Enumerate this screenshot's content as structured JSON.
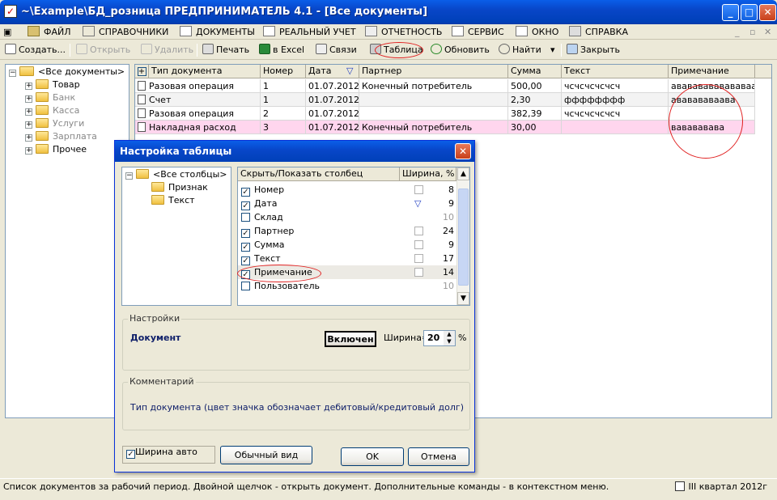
{
  "window": {
    "title": "~\\Example\\БД_розница  ПРЕДПРИНИМАТЕЛЬ 4.1 - [Все документы]"
  },
  "menu": [
    {
      "label": "ФАЙЛ",
      "icon": "folder-open-icon"
    },
    {
      "label": "СПРАВОЧНИКИ",
      "icon": "home-icon"
    },
    {
      "label": "ДОКУМЕНТЫ",
      "icon": "document-icon"
    },
    {
      "label": "РЕАЛЬНЫЙ УЧЕТ",
      "icon": "list-icon"
    },
    {
      "label": "ОТЧЕТНОСТЬ",
      "icon": "report-icon"
    },
    {
      "label": "СЕРВИС",
      "icon": "service-icon"
    },
    {
      "label": "ОКНО",
      "icon": "window-icon"
    },
    {
      "label": "СПРАВКА",
      "icon": "help-book-icon"
    }
  ],
  "toolbar": {
    "create": "Создать...",
    "open": "Открыть",
    "delete": "Удалить",
    "print": "Печать",
    "excel": "в Excel",
    "links": "Связи",
    "table": "Таблица",
    "refresh": "Обновить",
    "find": "Найти",
    "close": "Закрыть"
  },
  "tree": {
    "root": "<Все документы>",
    "items": [
      "Товар",
      "Банк",
      "Касса",
      "Услуги",
      "Зарплата",
      "Прочее"
    ]
  },
  "grid": {
    "columns": [
      "Тип документа",
      "Номер",
      "Дата",
      "Партнер",
      "Сумма",
      "Текст",
      "Примечание"
    ],
    "rows": [
      [
        "Разовая операция",
        "1",
        "01.07.2012",
        "Конечный потребитель",
        "500,00",
        "чсчсчсчсчсч",
        "авававававававаав"
      ],
      [
        "Счет",
        "1",
        "01.07.2012",
        "",
        "2,30",
        "фффффффф",
        "ававававаава"
      ],
      [
        "Разовая операция",
        "2",
        "01.07.2012",
        "",
        "382,39",
        "чсчсчсчсчсч",
        ""
      ],
      [
        "Накладная расход",
        "3",
        "01.07.2012",
        "Конечный потребитель",
        "30,00",
        "",
        "вавававава"
      ]
    ],
    "highlight_color": "#ffd6ee"
  },
  "dialog": {
    "title": "Настройка таблицы",
    "tree": {
      "root": "<Все столбцы>",
      "items": [
        "Признак",
        "Текст"
      ]
    },
    "list_headers": {
      "name": "Скрыть/Показать столбец",
      "width": "Ширина, %"
    },
    "columns": [
      {
        "name": "Номер",
        "checked": true,
        "width": "8"
      },
      {
        "name": "Дата",
        "checked": true,
        "width": "9"
      },
      {
        "name": "Склад",
        "checked": false,
        "width": "10"
      },
      {
        "name": "Партнер",
        "checked": true,
        "width": "24"
      },
      {
        "name": "Сумма",
        "checked": true,
        "width": "9"
      },
      {
        "name": "Текст",
        "checked": true,
        "width": "17"
      },
      {
        "name": "Примечание",
        "checked": true,
        "width": "14"
      },
      {
        "name": "Пользователь",
        "checked": false,
        "width": "10"
      }
    ],
    "settings_label": "Настройки",
    "doc_label": "Документ",
    "toggle_button": "Включен",
    "width_label": "Ширина=",
    "width_value": "20",
    "percent": "%",
    "comment_label": "Комментарий",
    "comment_text": "Тип документа (цвет значка обозначает дебитовый/кредитовый долг)",
    "auto_width": "Ширина авто",
    "normal_view": "Обычный вид",
    "ok": "OK",
    "cancel": "Отмена"
  },
  "status": {
    "text": "Список документов за рабочий период. Двойной щелчок - открыть документ. Дополнительные команды - в контекстном меню.",
    "period": "III квартал 2012г"
  }
}
